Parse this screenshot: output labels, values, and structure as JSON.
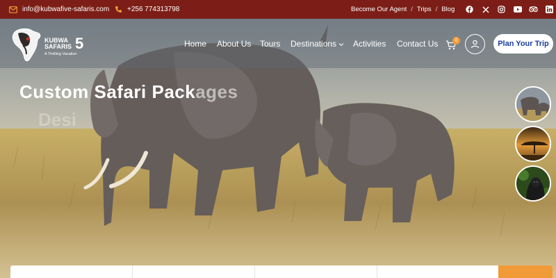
{
  "topbar": {
    "email": "info@kubwafive-safaris.com",
    "phone": "+256 774313798",
    "links": [
      "Become Our Agent",
      "Trips",
      "Blog"
    ],
    "separator": "/",
    "social_icons": [
      "facebook-icon",
      "x-icon",
      "instagram-icon",
      "youtube-icon",
      "tripadvisor-icon",
      "linkedin-icon"
    ]
  },
  "logo": {
    "line1": "KUBWA",
    "line2": "SAFARIS",
    "number": "5",
    "tagline": "A Thrilling Vacation"
  },
  "nav": {
    "items": [
      "Home",
      "About Us",
      "Tours",
      "Destinations",
      "Activities",
      "Contact Us"
    ],
    "cart_count": "0",
    "cta": "Plan Your Trip"
  },
  "hero": {
    "title_main": "Custom Safari Pack",
    "title_fade": "ages",
    "subtitle": "Desi"
  },
  "colors": {
    "topbar": "#7c1e17",
    "cta_text": "#1b3fa0",
    "accent": "#f29a35"
  }
}
